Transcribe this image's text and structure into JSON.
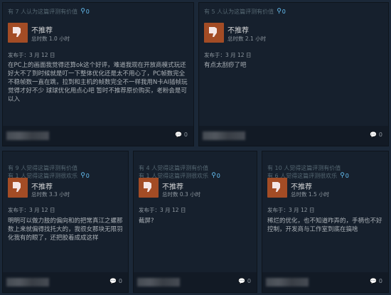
{
  "reviews": [
    {
      "helpful": "有 7 人认为这篇评测有价值",
      "awards": "0",
      "verdict": "不推荐",
      "hours": "总时数 1.0 小时",
      "posted": "发布于：3 月 12 日",
      "body": "在PC上的画面我觉得还算ok这个好评，难道我现在开放商模式玩还好大不了到时候就是叮一下整体优化还是太不用心了，PC帧数完全不稳帧数一直在跳，拉到和主机的帧数完全不一样我用N卡AI插帧玩觉得才好不少 球球优化用点心吧 暂时不推荐原价购买，老粉会是可以入",
      "comments": "0"
    },
    {
      "helpful": "有 5 人认为这篇评测有价值",
      "awards": "0",
      "verdict": "不推荐",
      "hours": "总时数 2.1 小时",
      "posted": "发布于：3 月 12 日",
      "body": "有点太刮痧了吧",
      "comments": "0"
    },
    {
      "helpful": "有 9 人觉得这篇评测有价值\n有 1 人觉得这篇评测很欢乐",
      "awards": "0",
      "verdict": "不推荐",
      "hours": "总时数 3.3 小时",
      "posted": "发布于：3 月 12 日",
      "body": "明明可以做力肢的偏向和的把常真江之螺那数上来就偏得找托大的，我很女那块无限羽化我有的眼了，还把胶着成成这样",
      "comments": "0"
    },
    {
      "helpful": "有 4 人觉得这篇评测有价值\n有 1 人觉得这篇评测很欢乐",
      "awards": "0",
      "verdict": "不推荐",
      "hours": "总时数 0.3 小时",
      "posted": "发布于：3 月 12 日",
      "body": "截屏?",
      "comments": "0"
    },
    {
      "helpful": "有 10 人觉得这篇评测有价值\n有 6 人觉得这篇评测很欢乐",
      "awards": "0",
      "verdict": "不推荐",
      "hours": "总时数 1.5 小时",
      "posted": "发布于：3 月 12 日",
      "body": "稀烂的优化，也不知道咋弄的，手柄也不好控制，开发商与工作室到底在搞啥",
      "comments": "0"
    }
  ],
  "colors": {
    "background": "#1b2838",
    "card": "#16202d",
    "thumb_down": "#a34c25",
    "award": "#66c0f4"
  },
  "icons": {
    "thumb": "thumbs-down-icon",
    "award": "award-icon",
    "comment": "comment-icon"
  }
}
